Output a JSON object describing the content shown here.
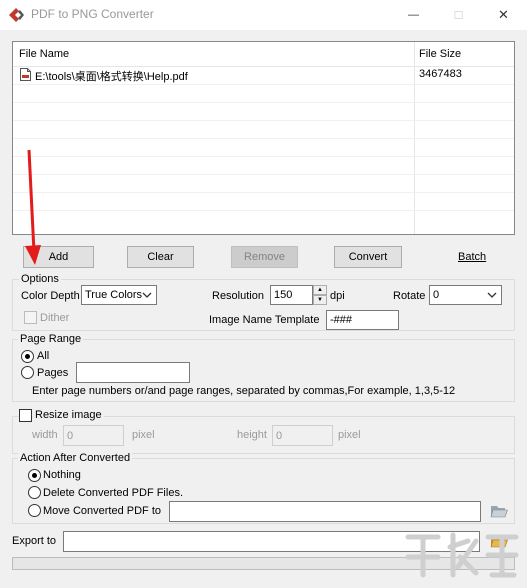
{
  "window": {
    "title": "PDF to PNG Converter",
    "minimize_glyph": "—",
    "maximize_glyph": "☐",
    "close_glyph": "✕"
  },
  "file_list": {
    "columns": [
      "File Name",
      "File Size"
    ],
    "rows": [
      {
        "name": "E:\\tools\\桌面\\格式转换\\Help.pdf",
        "size": "3467483"
      }
    ]
  },
  "toolbar": {
    "add": "Add",
    "clear": "Clear",
    "remove": "Remove",
    "convert": "Convert",
    "batch": "Batch"
  },
  "options": {
    "legend": "Options",
    "color_depth_label": "Color Depth",
    "color_depth_value": "True Colors",
    "resolution_label": "Resolution",
    "resolution_value": "150",
    "dpi_label": "dpi",
    "rotate_label": "Rotate",
    "rotate_value": "0",
    "dither_label": "Dither",
    "dither_checked": false,
    "image_name_template_label": "Image Name Template",
    "image_name_template_value": "-###"
  },
  "page_range": {
    "legend": "Page Range",
    "all_label": "All",
    "pages_label": "Pages",
    "pages_value": "",
    "selected": "all",
    "hint": "Enter page numbers or/and page ranges, separated by commas,For example, 1,3,5-12"
  },
  "resize": {
    "legend": "Resize image",
    "checked": false,
    "width_label": "width",
    "width_value": "0",
    "width_unit": "pixel",
    "height_label": "height",
    "height_value": "0",
    "height_unit": "pixel"
  },
  "after_convert": {
    "legend": "Action After Converted",
    "nothing_label": "Nothing",
    "delete_label": "Delete Converted PDF Files.",
    "move_label": "Move Converted PDF to",
    "move_path": "",
    "selected": "nothing"
  },
  "export": {
    "label": "Export to",
    "path": ""
  },
  "progress": {
    "value": 0
  },
  "icons": {
    "app": "app-logo-icon",
    "file": "pdf-file-icon",
    "folder": "open-folder-icon"
  },
  "colors": {
    "arrow": "#e31b1b",
    "app_icon_red": "#c0392b",
    "folder_yellow": "#e8b84a"
  }
}
